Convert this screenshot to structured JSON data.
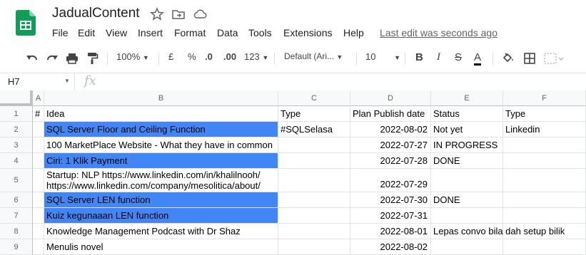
{
  "doc": {
    "title": "JadualContent",
    "last_edit": "Last edit was seconds ago"
  },
  "menu": [
    "File",
    "Edit",
    "View",
    "Insert",
    "Format",
    "Data",
    "Tools",
    "Extensions",
    "Help"
  ],
  "toolbar": {
    "zoom": "100%",
    "currency": "£",
    "percent": "%",
    "dec_decrease": ".0",
    "dec_increase": ".00",
    "more_formats": "123",
    "font": "Default (Ari...",
    "font_size": "10",
    "bold": "B",
    "italic": "I",
    "strike": "S",
    "text_color": "A"
  },
  "formula_bar": {
    "cell_ref": "H7",
    "fx": "fx"
  },
  "columns": [
    "A",
    "B",
    "C",
    "D",
    "E",
    "F"
  ],
  "rows": [
    {
      "num": "1",
      "cells": [
        "#",
        "Idea",
        "Type",
        "Plan Publish date",
        "Status",
        "Type"
      ],
      "hl": false
    },
    {
      "num": "2",
      "cells": [
        "",
        "SQL Server Floor and  Ceiling Function",
        "#SQLSelasa",
        "2022-08-02",
        "Not yet",
        "Linkedin"
      ],
      "hl": true
    },
    {
      "num": "3",
      "cells": [
        "",
        "100 MarketPlace Website - What they have in common",
        "",
        "2022-07-27",
        "IN PROGRESS",
        ""
      ],
      "hl": false
    },
    {
      "num": "4",
      "cells": [
        "",
        "Ciri:  1 Klik Payment",
        "",
        "2022-07-28",
        "DONE",
        ""
      ],
      "hl": true
    },
    {
      "num": "5",
      "cells": [
        "",
        "Startup: NLP https://www.linkedin.com/in/khalilnooh/\nhttps://www.linkedin.com/company/mesolitica/about/",
        "",
        "2022-07-29",
        "",
        ""
      ],
      "hl": false
    },
    {
      "num": "6",
      "cells": [
        "",
        "SQL Server LEN function",
        "",
        "2022-07-30",
        "DONE",
        ""
      ],
      "hl": true
    },
    {
      "num": "7",
      "cells": [
        "",
        "Kuiz kegunaaan  LEN function",
        "",
        "2022-07-31",
        "",
        ""
      ],
      "hl": true
    },
    {
      "num": "8",
      "cells": [
        "",
        "Knowledge Management  Podcast with Dr Shaz",
        "",
        "2022-08-01",
        "Lepas convo bila dah setup bilik",
        ""
      ],
      "hl": false
    },
    {
      "num": "9",
      "cells": [
        "",
        "Menulis novel",
        "",
        "2022-08-02",
        "",
        ""
      ],
      "hl": false
    }
  ],
  "colors": {
    "highlight": "#4285f4",
    "sheets_green": "#0f9d58"
  }
}
